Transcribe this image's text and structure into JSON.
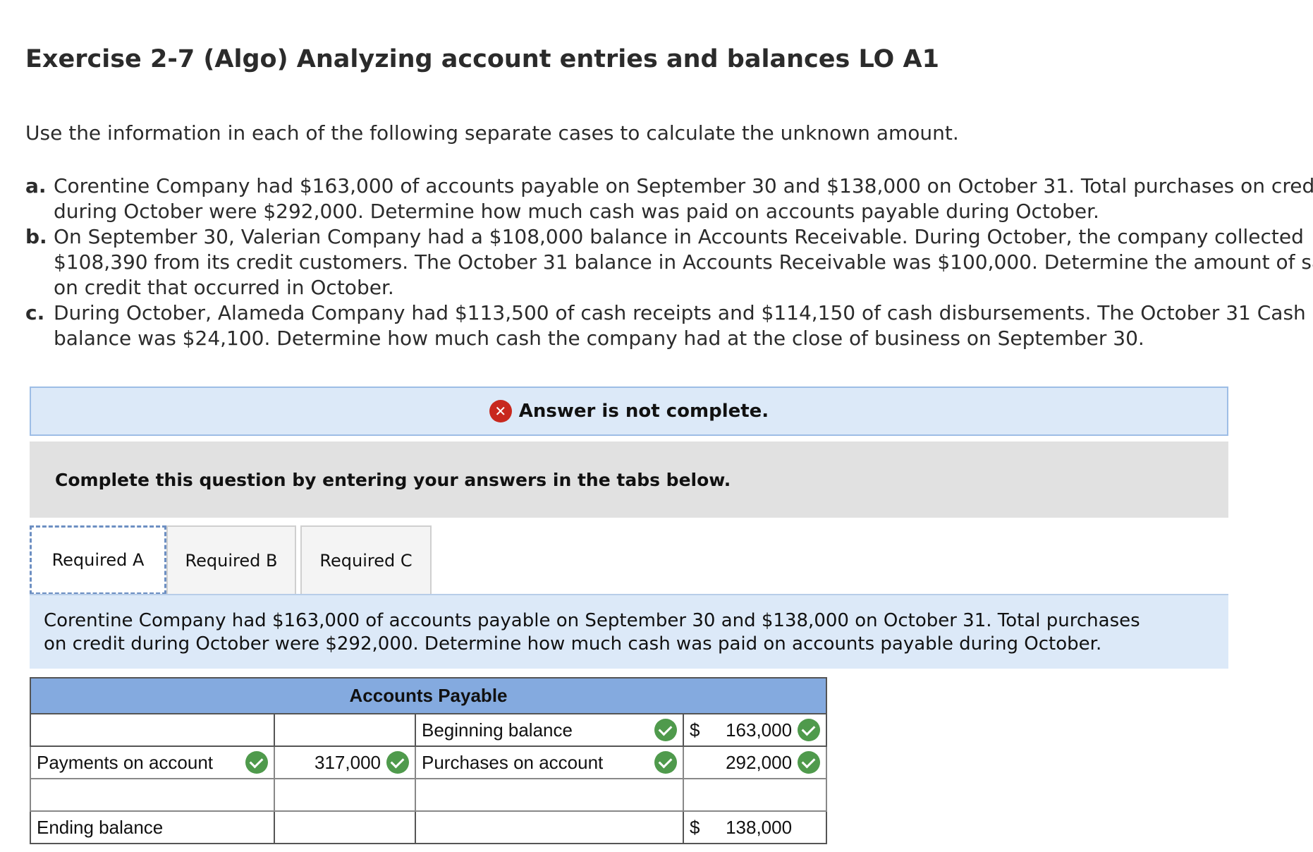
{
  "title": "Exercise 2-7 (Algo) Analyzing account entries and balances LO A1",
  "intro": "Use the information in each of the following separate cases to calculate the unknown amount.",
  "cases": [
    {
      "letter": "a.",
      "lines": [
        "Corentine Company had $163,000 of accounts payable on September 30 and $138,000 on October 31. Total purchases on credit",
        "during October were $292,000. Determine how much cash was paid on accounts payable during October."
      ]
    },
    {
      "letter": "b.",
      "lines": [
        "On September 30, Valerian Company had a $108,000 balance in Accounts Receivable. During October, the company collected",
        "$108,390 from its credit customers. The October 31 balance in Accounts Receivable was $100,000. Determine the amount of sales",
        "on credit that occurred in October."
      ]
    },
    {
      "letter": "c.",
      "lines": [
        "During October, Alameda Company had $113,500 of cash receipts and $114,150 of cash disbursements. The October 31 Cash",
        "balance was $24,100. Determine how much cash the company had at the close of business on September 30."
      ]
    }
  ],
  "status": {
    "text": "Answer is not complete.",
    "icon": "x-circle-icon",
    "color": "#c8281e"
  },
  "instruction": "Complete this question by entering your answers in the tabs below.",
  "tabs": [
    {
      "label": "Required A",
      "active": true
    },
    {
      "label": "Required B",
      "active": false
    },
    {
      "label": "Required C",
      "active": false
    }
  ],
  "prompt": {
    "lines": [
      "Corentine Company had $163,000 of accounts payable on September 30 and $138,000 on October 31. Total purchases",
      "on credit during October were $292,000. Determine how much cash was paid on accounts payable during October."
    ]
  },
  "t_account": {
    "title": "Accounts Payable",
    "row1": {
      "right_label": "Beginning balance",
      "right_currency": "$",
      "right_value": "163,000"
    },
    "row2": {
      "left_label": "Payments on account",
      "left_value": "317,000",
      "right_label": "Purchases on account",
      "right_value": "292,000"
    },
    "row4": {
      "left_label": "Ending balance",
      "right_currency": "$",
      "right_value": "138,000"
    }
  },
  "colors": {
    "header_blue": "#84aadf",
    "panel_blue": "#dce9f8",
    "check_green": "#4f9a4c",
    "error_red": "#c8281e"
  }
}
